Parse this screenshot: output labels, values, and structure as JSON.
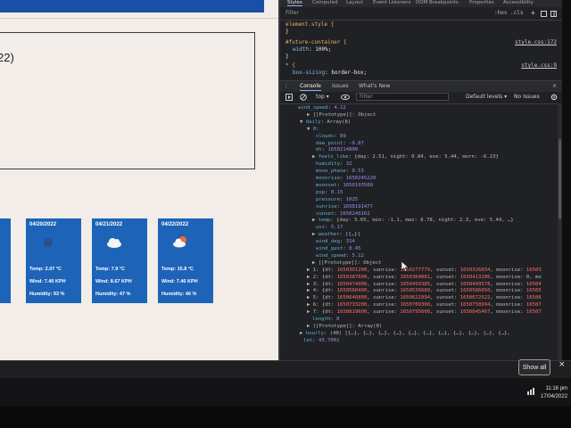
{
  "page": {
    "card_suffix": "22)",
    "days": [
      {
        "date": "",
        "temp": "",
        "wind": "",
        "humidity": "",
        "icon": "none"
      },
      {
        "date": "04/20/2022",
        "temp": "Temp: 2.07 °C",
        "wind": "Wind: 7.40 KPH",
        "humidity": "Humidity: 93 %",
        "icon": "moon-icon"
      },
      {
        "date": "04/21/2022",
        "temp": "Temp: 7.9 °C",
        "wind": "Wind: 8.67 KPH",
        "humidity": "Humidity: 47 %",
        "icon": "cloud-icon"
      },
      {
        "date": "04/22/2022",
        "temp": "Temp: 15.8 °C",
        "wind": "Wind: 7.46 KPH",
        "humidity": "Humidity: 46 %",
        "icon": "sun-cloud-icon"
      }
    ]
  },
  "devtools": {
    "tabs": [
      "Styles",
      "Computed",
      "Layout",
      "Event Listeners",
      "DOM Breakpoints",
      "Properties",
      "Accessibility"
    ],
    "styles_filter_placeholder": "Filter",
    "hov_cls": ":hov  .cls",
    "add_symbol": "+",
    "styles": {
      "element_style": "element.style {",
      "close1": "}",
      "rule1_selector": "#future-container {",
      "rule1_link": "style.css:172",
      "rule1_prop": "width",
      "rule1_val": "100%;",
      "close2": "}",
      "rule2_selector": "* {",
      "rule2_link": "style.css:9",
      "rule2_prop": "box-sizing",
      "rule2_val": "border-box;"
    },
    "console_tabs": [
      "Console",
      "Issues",
      "What's New"
    ],
    "console_close": "×",
    "toolbar": {
      "context": "top ▾",
      "filter_placeholder": "Filter",
      "levels": "Default levels ▾",
      "issues": "No Issues"
    },
    "console_lines": [
      {
        "indent": 20,
        "parts": [
          [
            "k",
            "wind_speed"
          ],
          [
            "p",
            ": "
          ],
          [
            "n",
            "4.12"
          ]
        ]
      },
      {
        "indent": 30,
        "parts": [
          [
            "p",
            "▶ [[Prototype]]: Object"
          ]
        ]
      },
      {
        "indent": 22,
        "parts": [
          [
            "p",
            "▼ "
          ],
          [
            "k",
            "daily"
          ],
          [
            "p",
            ": Array(8)"
          ]
        ]
      },
      {
        "indent": 30,
        "parts": [
          [
            "p",
            "▼ "
          ],
          [
            "k",
            "0"
          ],
          [
            "p",
            ":"
          ]
        ]
      },
      {
        "indent": 40,
        "parts": [
          [
            "k",
            "clouds"
          ],
          [
            "p",
            ": "
          ],
          [
            "n",
            "89"
          ]
        ]
      },
      {
        "indent": 40,
        "parts": [
          [
            "k",
            "dew_point"
          ],
          [
            "p",
            ": "
          ],
          [
            "n",
            "-9.87"
          ]
        ]
      },
      {
        "indent": 40,
        "parts": [
          [
            "k",
            "dt"
          ],
          [
            "p",
            ": "
          ],
          [
            "n",
            "1650214800"
          ]
        ]
      },
      {
        "indent": 36,
        "parts": [
          [
            "p",
            "▶ "
          ],
          [
            "k",
            "feels_like"
          ],
          [
            "p",
            ": {day: 2.51, night: 0.84, eve: 5.44, morn: -6.23}"
          ]
        ]
      },
      {
        "indent": 40,
        "parts": [
          [
            "k",
            "humidity"
          ],
          [
            "p",
            ": "
          ],
          [
            "n",
            "32"
          ]
        ]
      },
      {
        "indent": 40,
        "parts": [
          [
            "k",
            "moon_phase"
          ],
          [
            "p",
            ": "
          ],
          [
            "n",
            "0.53"
          ]
        ]
      },
      {
        "indent": 40,
        "parts": [
          [
            "k",
            "moonrise"
          ],
          [
            "p",
            ": "
          ],
          [
            "n",
            "1650245220"
          ]
        ]
      },
      {
        "indent": 40,
        "parts": [
          [
            "k",
            "moonset"
          ],
          [
            "p",
            ": "
          ],
          [
            "n",
            "1650193500"
          ]
        ]
      },
      {
        "indent": 40,
        "parts": [
          [
            "k",
            "pop"
          ],
          [
            "p",
            ": "
          ],
          [
            "n",
            "0.15"
          ]
        ]
      },
      {
        "indent": 40,
        "parts": [
          [
            "k",
            "pressure"
          ],
          [
            "p",
            ": "
          ],
          [
            "n",
            "1025"
          ]
        ]
      },
      {
        "indent": 40,
        "parts": [
          [
            "k",
            "sunrise"
          ],
          [
            "p",
            ": "
          ],
          [
            "n",
            "1650191477"
          ]
        ]
      },
      {
        "indent": 40,
        "parts": [
          [
            "k",
            "sunset"
          ],
          [
            "p",
            ": "
          ],
          [
            "n",
            "1650240162"
          ]
        ]
      },
      {
        "indent": 36,
        "parts": [
          [
            "p",
            "▶ "
          ],
          [
            "k",
            "temp"
          ],
          [
            "p",
            ": {day: 5.65, min: -1.1, max: 6.78, night: 2.3, eve: 5.44, …}"
          ]
        ]
      },
      {
        "indent": 40,
        "parts": [
          [
            "k",
            "uvi"
          ],
          [
            "p",
            ": "
          ],
          [
            "n",
            "5.17"
          ]
        ]
      },
      {
        "indent": 36,
        "parts": [
          [
            "p",
            "▶ "
          ],
          [
            "k",
            "weather"
          ],
          [
            "p",
            ": [{…}]"
          ]
        ]
      },
      {
        "indent": 40,
        "parts": [
          [
            "k",
            "wind_deg"
          ],
          [
            "p",
            ": "
          ],
          [
            "n",
            "314"
          ]
        ]
      },
      {
        "indent": 40,
        "parts": [
          [
            "k",
            "wind_gust"
          ],
          [
            "p",
            ": "
          ],
          [
            "n",
            "8.45"
          ]
        ]
      },
      {
        "indent": 40,
        "parts": [
          [
            "k",
            "wind_speed"
          ],
          [
            "p",
            ": "
          ],
          [
            "n",
            "5.12"
          ]
        ]
      },
      {
        "indent": 36,
        "parts": [
          [
            "p",
            "▶ [[Prototype]]: Object"
          ]
        ]
      },
      {
        "indent": 30,
        "parts": [
          [
            "p",
            "▶ 1: {dt: "
          ],
          [
            "h",
            "1650301200"
          ],
          [
            "p",
            ", sunrise: "
          ],
          [
            "h",
            "1650277779"
          ],
          [
            "p",
            ", sunset: "
          ],
          [
            "h",
            "1650326834"
          ],
          [
            "p",
            ", moonrise: "
          ],
          [
            "h",
            "16503"
          ]
        ]
      },
      {
        "indent": 30,
        "parts": [
          [
            "p",
            "▶ 2: {dt: "
          ],
          [
            "h",
            "1650387600"
          ],
          [
            "p",
            ", sunrise: "
          ],
          [
            "h",
            "1650364081"
          ],
          [
            "p",
            ", sunset: "
          ],
          [
            "h",
            "1650413106"
          ],
          [
            "p",
            ", moonrise: 0, mo"
          ]
        ]
      },
      {
        "indent": 30,
        "parts": [
          [
            "p",
            "▶ 3: {dt: "
          ],
          [
            "h",
            "1650474000"
          ],
          [
            "p",
            ", sunrise: "
          ],
          [
            "h",
            "1650450385"
          ],
          [
            "p",
            ", sunset: "
          ],
          [
            "h",
            "1650499578"
          ],
          [
            "p",
            ", moonrise: "
          ],
          [
            "h",
            "16504"
          ]
        ]
      },
      {
        "indent": 30,
        "parts": [
          [
            "p",
            "▶ 4: {dt: "
          ],
          [
            "h",
            "1650560400"
          ],
          [
            "p",
            ", sunrise: "
          ],
          [
            "h",
            "1650536689"
          ],
          [
            "p",
            ", sunset: "
          ],
          [
            "h",
            "1650586050"
          ],
          [
            "p",
            ", moonrise: "
          ],
          [
            "h",
            "16505"
          ]
        ]
      },
      {
        "indent": 30,
        "parts": [
          [
            "p",
            "▶ 5: {dt: "
          ],
          [
            "h",
            "1650646800"
          ],
          [
            "p",
            ", sunrise: "
          ],
          [
            "h",
            "1650622994"
          ],
          [
            "p",
            ", sunset: "
          ],
          [
            "h",
            "1650672522"
          ],
          [
            "p",
            ", moonrise: "
          ],
          [
            "h",
            "16506"
          ]
        ]
      },
      {
        "indent": 30,
        "parts": [
          [
            "p",
            "▶ 6: {dt: "
          ],
          [
            "h",
            "1650733200"
          ],
          [
            "p",
            ", sunrise: "
          ],
          [
            "h",
            "1650709300"
          ],
          [
            "p",
            ", sunset: "
          ],
          [
            "h",
            "1650758994"
          ],
          [
            "p",
            ", moonrise: "
          ],
          [
            "h",
            "16507"
          ]
        ]
      },
      {
        "indent": 30,
        "parts": [
          [
            "p",
            "▶ 7: {dt: "
          ],
          [
            "h",
            "1650819600"
          ],
          [
            "p",
            ", sunrise: "
          ],
          [
            "h",
            "1650795608"
          ],
          [
            "p",
            ", sunset: "
          ],
          [
            "h",
            "1650845467"
          ],
          [
            "p",
            ", moonrise: "
          ],
          [
            "h",
            "16507"
          ]
        ]
      },
      {
        "indent": 36,
        "parts": [
          [
            "k",
            "length"
          ],
          [
            "p",
            ": "
          ],
          [
            "n",
            "8"
          ]
        ]
      },
      {
        "indent": 30,
        "parts": [
          [
            "p",
            "▶ [[Prototype]]: Array(0)"
          ]
        ]
      },
      {
        "indent": 22,
        "parts": [
          [
            "p",
            "▶ "
          ],
          [
            "k",
            "hourly"
          ],
          [
            "p",
            ": (48) [{…}, {…}, {…}, {…}, {…}, {…}, {…}, {…}, {…}, {…}, {…},"
          ]
        ]
      },
      {
        "indent": 26,
        "parts": [
          [
            "k",
            "lat"
          ],
          [
            "p",
            ": "
          ],
          [
            "n",
            "43.7001"
          ]
        ]
      }
    ]
  },
  "download_bar": {
    "show_all": "Show all",
    "close": "×"
  },
  "taskbar": {
    "time": "11:16 pm",
    "date": "17/04/2022"
  },
  "colors": {
    "card_blue": "#1d63b8",
    "devtools_bg": "#202124",
    "key": "#5db0d7",
    "number": "#9b8ff0",
    "highlight": "#ff6b6b"
  }
}
